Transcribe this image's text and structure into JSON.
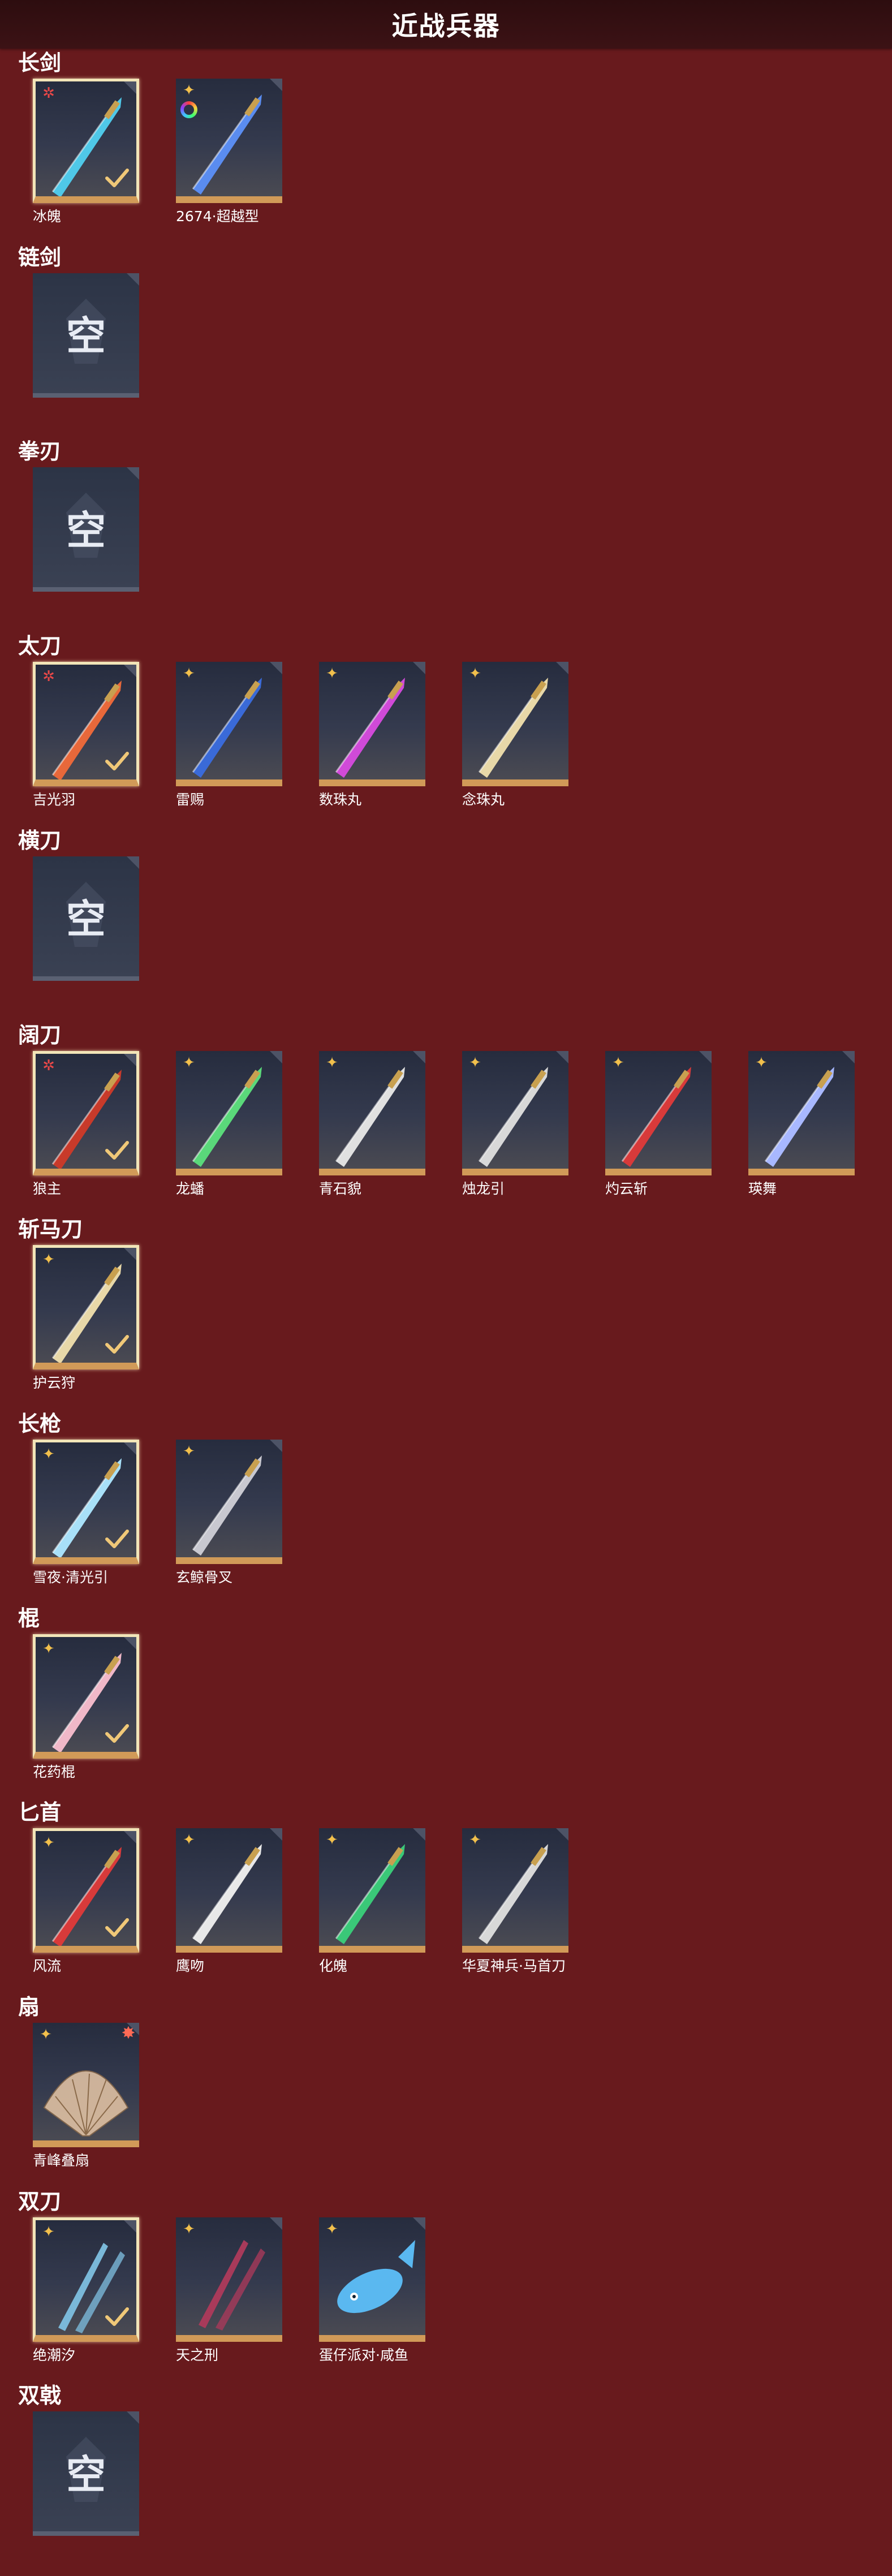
{
  "header": {
    "title": "近战兵器"
  },
  "sections": [
    {
      "title": "长剑",
      "items": [
        {
          "name": "冰魄",
          "rarity": "red",
          "selected": true,
          "checked": true,
          "color": "#4fc8e8",
          "icon": "sword-icon"
        },
        {
          "name": "2674·超越型",
          "rarity": "gold",
          "ring": true,
          "color": "#5a8cf0",
          "icon": "sword-icon"
        }
      ]
    },
    {
      "title": "链剑",
      "empty": "空"
    },
    {
      "title": "拳刃",
      "empty": "空"
    },
    {
      "title": "太刀",
      "items": [
        {
          "name": "吉光羽",
          "rarity": "red",
          "selected": true,
          "checked": true,
          "color": "#e8683a",
          "icon": "katana-icon"
        },
        {
          "name": "雷赐",
          "rarity": "gold",
          "color": "#3a6ad8",
          "icon": "katana-icon"
        },
        {
          "name": "数珠丸",
          "rarity": "gold",
          "color": "#d04ad8",
          "icon": "katana-icon"
        },
        {
          "name": "念珠丸",
          "rarity": "gold",
          "color": "#e8d8a8",
          "icon": "katana-icon"
        }
      ]
    },
    {
      "title": "横刀",
      "empty": "空"
    },
    {
      "title": "阔刀",
      "items": [
        {
          "name": "狼主",
          "rarity": "red",
          "selected": true,
          "checked": true,
          "color": "#c83a2a",
          "icon": "broadsword-icon"
        },
        {
          "name": "龙蟠",
          "rarity": "gold",
          "color": "#5ad87a",
          "icon": "broadsword-icon"
        },
        {
          "name": "青石貌",
          "rarity": "gold",
          "color": "#e0e0e0",
          "icon": "broadsword-icon"
        },
        {
          "name": "烛龙引",
          "rarity": "gold",
          "color": "#d8d8d8",
          "icon": "broadsword-icon"
        },
        {
          "name": "灼云斩",
          "rarity": "gold",
          "color": "#d83a3a",
          "icon": "broadsword-icon"
        },
        {
          "name": "瑛舞",
          "rarity": "gold",
          "color": "#a8b8ff",
          "icon": "broadsword-icon"
        }
      ]
    },
    {
      "title": "斩马刀",
      "items": [
        {
          "name": "护云狩",
          "rarity": "gold",
          "selected": true,
          "checked": true,
          "color": "#e8d8a8",
          "icon": "zhanmadao-icon"
        }
      ]
    },
    {
      "title": "长枪",
      "items": [
        {
          "name": "雪夜·清光引",
          "rarity": "gold",
          "selected": true,
          "checked": true,
          "color": "#a8e0f8",
          "icon": "spear-icon"
        },
        {
          "name": "玄鲸骨叉",
          "rarity": "gold",
          "color": "#c8c8d0",
          "icon": "trident-icon"
        }
      ]
    },
    {
      "title": "棍",
      "items": [
        {
          "name": "花药棍",
          "rarity": "gold",
          "selected": true,
          "checked": true,
          "color": "#f0b8c8",
          "icon": "staff-icon"
        }
      ]
    },
    {
      "title": "匕首",
      "items": [
        {
          "name": "风流",
          "rarity": "gold",
          "selected": true,
          "checked": true,
          "color": "#d83a3a",
          "icon": "dagger-icon"
        },
        {
          "name": "鹰吻",
          "rarity": "gold",
          "color": "#e8e8e8",
          "icon": "dagger-icon"
        },
        {
          "name": "化魄",
          "rarity": "gold",
          "color": "#3ac878",
          "icon": "dagger-icon"
        },
        {
          "name": "华夏神兵·马首刀",
          "rarity": "gold",
          "color": "#d8d8d8",
          "icon": "dagger-icon"
        }
      ]
    },
    {
      "title": "扇",
      "items": [
        {
          "name": "青峰叠扇",
          "rarity": "gold",
          "badge": true,
          "color": "#e8c8a8",
          "icon": "fan-icon"
        }
      ]
    },
    {
      "title": "双刀",
      "items": [
        {
          "name": "绝潮汐",
          "rarity": "gold",
          "selected": true,
          "checked": true,
          "color": "#7ab8d8",
          "icon": "dual-blades-icon"
        },
        {
          "name": "天之刑",
          "rarity": "gold",
          "color": "#a83a5a",
          "icon": "dual-blades-icon"
        },
        {
          "name": "蛋仔派对·咸鱼",
          "rarity": "gold",
          "color": "#5ab8f0",
          "icon": "fish-icon"
        }
      ]
    },
    {
      "title": "双戟",
      "empty": "空"
    }
  ]
}
